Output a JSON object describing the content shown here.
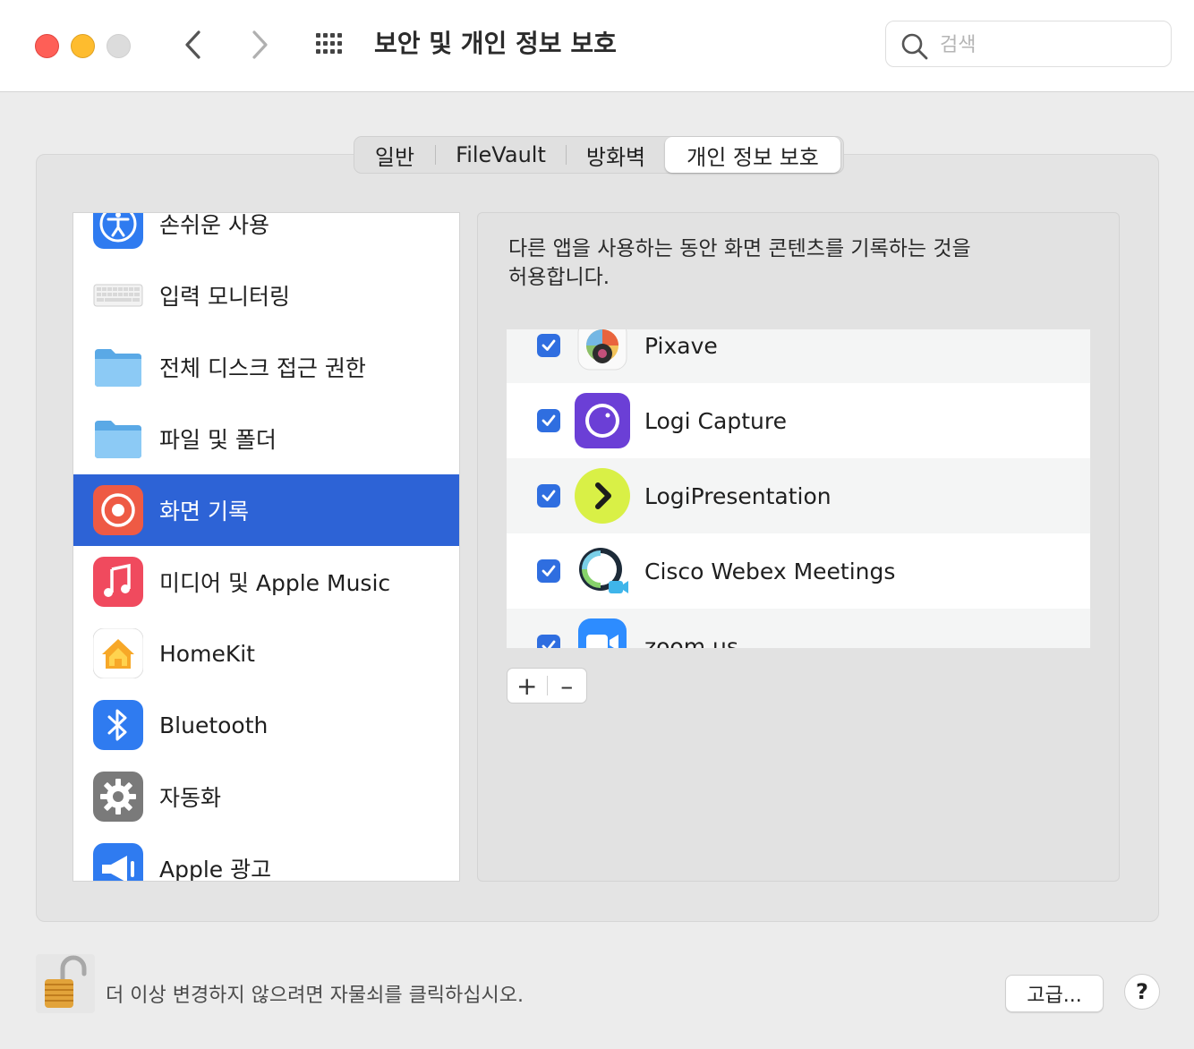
{
  "window": {
    "title": "보안 및 개인 정보 보호",
    "search_placeholder": "검색"
  },
  "tabs": [
    {
      "label": "일반",
      "active": false
    },
    {
      "label": "FileVault",
      "active": false
    },
    {
      "label": "방화벽",
      "active": false
    },
    {
      "label": "개인 정보 보호",
      "active": true
    }
  ],
  "sidebar": {
    "items": [
      {
        "label": "손쉬운 사용",
        "icon": "accessibility-icon"
      },
      {
        "label": "입력 모니터링",
        "icon": "keyboard-icon"
      },
      {
        "label": "전체 디스크 접근 권한",
        "icon": "folder-icon"
      },
      {
        "label": "파일 및 폴더",
        "icon": "folder-icon"
      },
      {
        "label": "화면 기록",
        "icon": "screen-record-icon",
        "selected": true
      },
      {
        "label": "미디어 및 Apple Music",
        "icon": "music-icon"
      },
      {
        "label": "HomeKit",
        "icon": "home-icon"
      },
      {
        "label": "Bluetooth",
        "icon": "bluetooth-icon"
      },
      {
        "label": "자동화",
        "icon": "gear-icon"
      },
      {
        "label": "Apple 광고",
        "icon": "megaphone-icon"
      }
    ]
  },
  "main": {
    "description": "다른 앱을 사용하는 동안 화면 콘텐츠를 기록하는 것을 허용합니다.",
    "apps": [
      {
        "name": "Pixave",
        "checked": true
      },
      {
        "name": "Logi Capture",
        "checked": true
      },
      {
        "name": "LogiPresentation",
        "checked": true
      },
      {
        "name": "Cisco Webex Meetings",
        "checked": true
      },
      {
        "name": "zoom.us",
        "checked": true
      }
    ],
    "add_label": "+",
    "remove_label": "–"
  },
  "footer": {
    "lock_text": "더 이상 변경하지 않으려면 자물쇠를 클릭하십시오.",
    "advanced_label": "고급...",
    "help_label": "?"
  },
  "colors": {
    "selection": "#2d63d6",
    "checkbox": "#2f6ee0"
  }
}
